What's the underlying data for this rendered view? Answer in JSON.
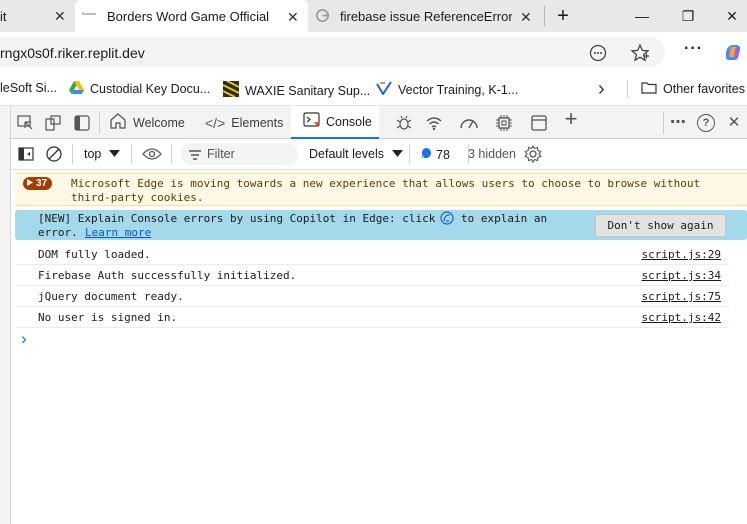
{
  "tabs": [
    {
      "label": "it",
      "close": "✕"
    },
    {
      "label": "Borders Word Game Official",
      "favicon_text": "Borders",
      "close": "✕"
    },
    {
      "label": "firebase issue ReferenceError: Ca",
      "close": "✕"
    }
  ],
  "new_tab": "+",
  "window_controls": {
    "minimize": "—",
    "restore": "❐",
    "close": "✕"
  },
  "address": {
    "url": "rngx0s0f.riker.replit.dev",
    "more": "···"
  },
  "favorites": [
    {
      "label": "leSoft Si..."
    },
    {
      "label": "Custodial Key Docu..."
    },
    {
      "label": "WAXIE Sanitary Sup..."
    },
    {
      "label": "Vector Training, K-1..."
    }
  ],
  "favorites_overflow": "›",
  "other_favorites": "Other favorites",
  "devtools": {
    "tabs": [
      {
        "label": "Welcome"
      },
      {
        "label": "Elements"
      },
      {
        "label": "Console"
      }
    ],
    "more": "⋯",
    "help": "?",
    "close": "✕",
    "add": "+"
  },
  "toolbar": {
    "context": "top",
    "filter_placeholder": "Filter",
    "levels": "Default levels",
    "issues_count": "78",
    "hidden": "3 hidden"
  },
  "warning": {
    "badge": "37",
    "text": "Microsoft Edge is moving towards a new experience that allows users to choose to browse without",
    "text2": "third-party cookies."
  },
  "info": {
    "text": "[NEW] Explain Console errors by using Copilot in Edge: click",
    "text_after_icon": "to explain an",
    "line2_prefix": "error.",
    "link": "Learn more",
    "button": "Don't show again"
  },
  "logs": [
    {
      "message": "DOM fully loaded.",
      "source": "script.js:29"
    },
    {
      "message": "Firebase Auth successfully initialized.",
      "source": "script.js:34"
    },
    {
      "message": "jQuery document ready.",
      "source": "script.js:75"
    },
    {
      "message": "No user is signed in.",
      "source": "script.js:42"
    }
  ],
  "prompt": "›",
  "colors": {
    "accent": "#1a73e8",
    "warning_bg": "#fef9e6",
    "info_bg": "#a3d9eb",
    "badge": "#a33c00"
  }
}
